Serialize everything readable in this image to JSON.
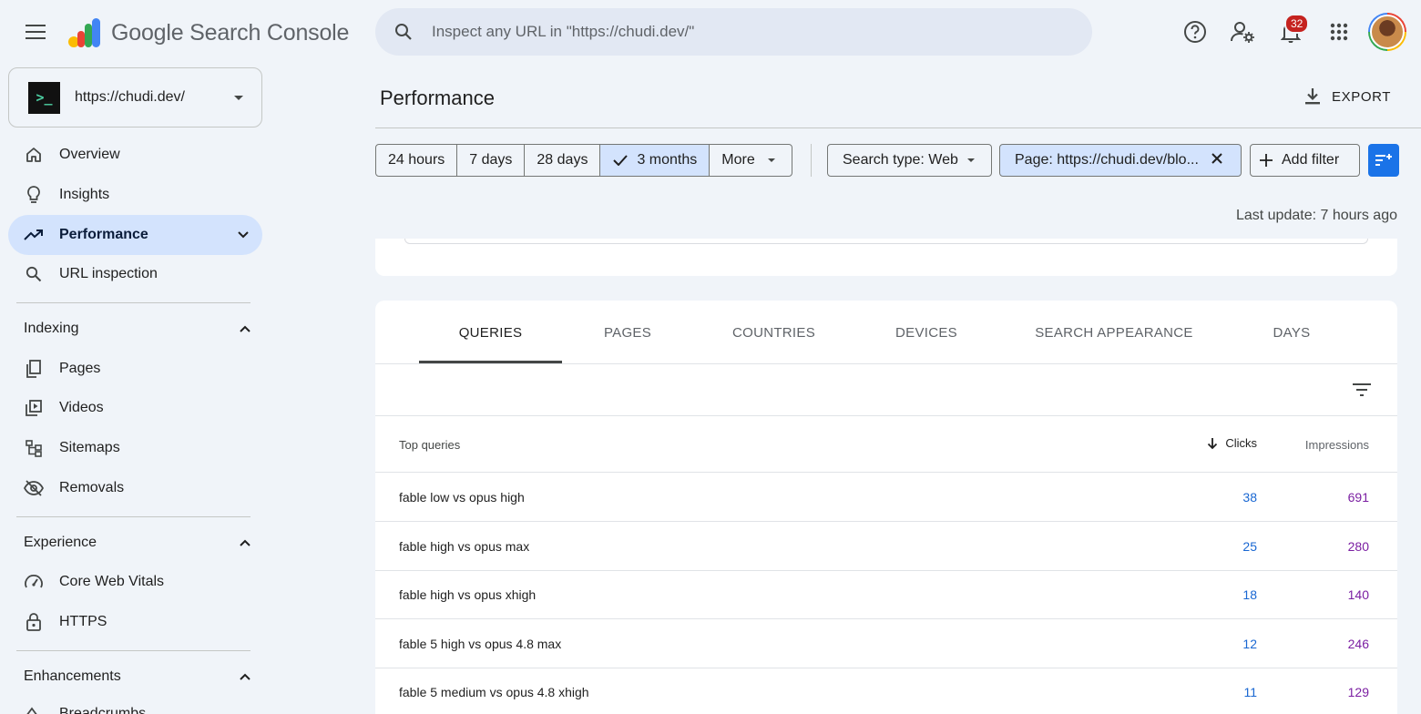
{
  "app": {
    "brand": "Google Search Console",
    "search_placeholder": "Inspect any URL in \"https://chudi.dev/\"",
    "notification_count": "32"
  },
  "property": {
    "name": "https://chudi.dev/",
    "icon_glyph": ">_"
  },
  "sidebar": {
    "main": [
      {
        "label": "Overview",
        "icon": "home-icon"
      },
      {
        "label": "Insights",
        "icon": "lightbulb-icon"
      },
      {
        "label": "Performance",
        "icon": "trending-up-icon",
        "active": true
      },
      {
        "label": "URL inspection",
        "icon": "search-icon"
      }
    ],
    "indexing": {
      "title": "Indexing",
      "items": [
        "Pages",
        "Videos",
        "Sitemaps",
        "Removals"
      ]
    },
    "experience": {
      "title": "Experience",
      "items": [
        "Core Web Vitals",
        "HTTPS"
      ]
    },
    "enhancements": {
      "title": "Enhancements",
      "partial_item": "Breadcrumbs"
    }
  },
  "header": {
    "title": "Performance",
    "export_label": "EXPORT"
  },
  "filters": {
    "date_ranges": [
      "24 hours",
      "7 days",
      "28 days",
      "3 months",
      "More"
    ],
    "selected_range": "3 months",
    "search_type": "Search type: Web",
    "page_filter": "Page: https://chudi.dev/blo...",
    "add_filter": "Add filter",
    "last_update": "Last update: 7 hours ago"
  },
  "tabs": [
    "QUERIES",
    "PAGES",
    "COUNTRIES",
    "DEVICES",
    "SEARCH APPEARANCE",
    "DAYS"
  ],
  "active_tab": "QUERIES",
  "table": {
    "columns": {
      "query": "Top queries",
      "clicks": "Clicks",
      "impressions": "Impressions"
    },
    "sort": "Clicks descending",
    "rows": [
      {
        "query": "fable low vs opus high",
        "clicks": "38",
        "impressions": "691"
      },
      {
        "query": "fable high vs opus max",
        "clicks": "25",
        "impressions": "280"
      },
      {
        "query": "fable high vs opus xhigh",
        "clicks": "18",
        "impressions": "140"
      },
      {
        "query": "fable 5 high vs opus 4.8 max",
        "clicks": "12",
        "impressions": "246"
      },
      {
        "query": "fable 5 medium vs opus 4.8 xhigh",
        "clicks": "11",
        "impressions": "129"
      }
    ]
  },
  "colors": {
    "accent": "#1a73e8",
    "selected": "#d3e3fd",
    "clicks": "#1967d2",
    "impressions": "#7b1fa2",
    "background": "#f0f4f9"
  }
}
